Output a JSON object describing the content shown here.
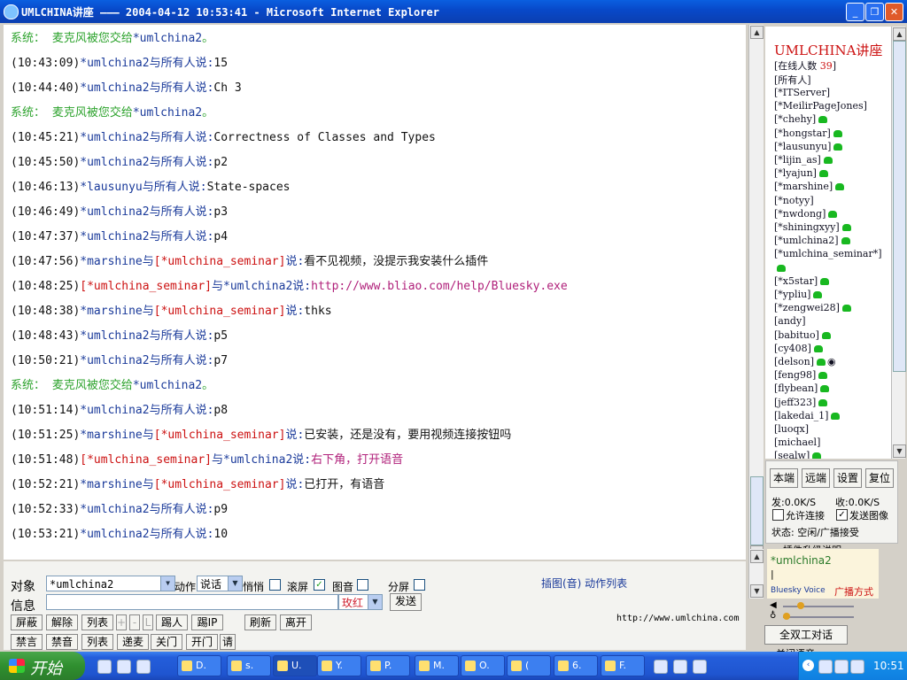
{
  "window": {
    "title": "UMLCHINA讲座 ——— 2004-04-12 10:53:41 - Microsoft Internet Explorer",
    "minimize": "_",
    "maximize": "❐",
    "close": "✕"
  },
  "chat": {
    "lines": [
      {
        "p": [
          "系统：  麦克风被您交给",
          "*umlchina2",
          "。"
        ]
      },
      {
        "p": [
          "(10:43:09)",
          "*umlchina2",
          "与所有人说:",
          "15"
        ]
      },
      {
        "p": [
          "(10:44:40)",
          "*umlchina2",
          "与所有人说:",
          "Ch 3"
        ]
      },
      {
        "p": [
          "系统：  麦克风被您交给",
          "*umlchina2",
          "。"
        ]
      },
      {
        "p": [
          "(10:45:21)",
          "*umlchina2",
          "与所有人说:",
          "Correctness of Classes and Types"
        ]
      },
      {
        "p": [
          "(10:45:50)",
          "*umlchina2",
          "与所有人说:",
          "p2"
        ]
      },
      {
        "p": [
          "(10:46:13)",
          "*lausunyu",
          "与所有人说:",
          "State-spaces"
        ]
      },
      {
        "p": [
          "(10:46:49)",
          "*umlchina2",
          "与所有人说:",
          "p3"
        ]
      },
      {
        "p": [
          "(10:47:37)",
          "*umlchina2",
          "与所有人说:",
          "p4"
        ]
      },
      {
        "p": [
          "(10:47:56)",
          "*marshine",
          "与",
          "[*umlchina_seminar]",
          "说:",
          "看不见视频，没提示我安装什么插件"
        ]
      },
      {
        "p": [
          "(10:48:25)",
          "[*umlchina_seminar]",
          "与",
          "*umlchina2",
          "说:",
          "http://www.bliao.com/help/Bluesky.exe"
        ]
      },
      {
        "p": [
          "(10:48:38)",
          "*marshine",
          "与",
          "[*umlchina_seminar]",
          "说:",
          "thks"
        ]
      },
      {
        "p": [
          "(10:48:43)",
          "*umlchina2",
          "与所有人说:",
          "p5"
        ]
      },
      {
        "p": [
          "(10:50:21)",
          "*umlchina2",
          "与所有人说:",
          "p7"
        ]
      },
      {
        "p": [
          "系统：  麦克风被您交给",
          "*umlchina2",
          "。"
        ]
      },
      {
        "p": [
          "(10:51:14)",
          "*umlchina2",
          "与所有人说:",
          "p8"
        ]
      },
      {
        "p": [
          "(10:51:25)",
          "*marshine",
          "与",
          "[*umlchina_seminar]",
          "说:",
          "已安装，还是没有，要用视频连接按钮吗"
        ]
      },
      {
        "p": [
          "(10:51:48)",
          "[*umlchina_seminar]",
          "与",
          "*umlchina2",
          "说:",
          "右下角，打开语音"
        ]
      },
      {
        "p": [
          "(10:52:21)",
          "*marshine",
          "与",
          "[*umlchina_seminar]",
          "说:",
          "已打开，有语音"
        ]
      },
      {
        "p": [
          "(10:52:33)",
          "*umlchina2",
          "与所有人说:",
          "p9"
        ]
      },
      {
        "p": [
          "(10:53:21)",
          "*umlchina2",
          "与所有人说:",
          "10"
        ]
      }
    ]
  },
  "input": {
    "target_label": "对象",
    "target_value": "*umlchina2",
    "action_label": "动作",
    "action_value": "说话",
    "whisper_label": "悄悄",
    "scroll_label": "滚屏",
    "image_sound_label": "图音",
    "split_label": "分屏",
    "message_label": "信息",
    "message_value": "",
    "color_value": "玫红",
    "send_button": "发送",
    "insert_link": "插图(音) 动作列表",
    "site_url": "http://www.umlchina.com",
    "row1_buttons": [
      "屏蔽",
      "解除",
      "列表",
      "+",
      "-",
      "L",
      "踢人",
      "踢IP",
      "刷新",
      "离开"
    ],
    "row2_buttons": [
      "禁言",
      "禁音",
      "列表",
      "递麦",
      "关门",
      "开门",
      "请"
    ]
  },
  "users": {
    "title": "UMLCHINA讲座",
    "online_label": "[在线人数 ",
    "online_count": "39",
    "online_suffix": "]",
    "everyone": "[所有人]",
    "list": [
      {
        "name": "[*ITServer]",
        "phone": false
      },
      {
        "name": "[*MeilirPageJones]",
        "phone": false
      },
      {
        "name": "[*chehy]",
        "phone": true
      },
      {
        "name": "[*hongstar]",
        "phone": true
      },
      {
        "name": "[*lausunyu]",
        "phone": true
      },
      {
        "name": "[*lijin_as]",
        "phone": true
      },
      {
        "name": "[*lyajun]",
        "phone": true
      },
      {
        "name": "[*marshine]",
        "phone": true
      },
      {
        "name": "[*notyy]",
        "phone": false
      },
      {
        "name": "[*nwdong]",
        "phone": true
      },
      {
        "name": "[*shiningxyy]",
        "phone": true
      },
      {
        "name": "[*umlchina2]",
        "phone": true
      },
      {
        "name": "[*umlchina_seminar*]",
        "phone": false
      },
      {
        "name": "",
        "phone": true
      },
      {
        "name": "[*x5star]",
        "phone": true
      },
      {
        "name": "[*ypliu]",
        "phone": true
      },
      {
        "name": "[*zengwei28]",
        "phone": true
      },
      {
        "name": "[andy]",
        "phone": false
      },
      {
        "name": "[babituo]",
        "phone": true
      },
      {
        "name": "[cy408]",
        "phone": true
      },
      {
        "name": "[delson]",
        "phone": true,
        "eye": true
      },
      {
        "name": "[feng98]",
        "phone": true
      },
      {
        "name": "[flybean]",
        "phone": true
      },
      {
        "name": "[jeff323]",
        "phone": true
      },
      {
        "name": "[lakedai_1]",
        "phone": true
      },
      {
        "name": "[luoqx]",
        "phone": false
      },
      {
        "name": "[michael]",
        "phone": false
      },
      {
        "name": "[sealw]",
        "phone": true
      }
    ]
  },
  "control": {
    "buttons": [
      "本端",
      "远端",
      "设置",
      "复位"
    ],
    "send_rate": "发:0.0K/S",
    "recv_rate": "收:0.0K/S",
    "allow_connect": "允许连接",
    "send_image": "发送图像",
    "status": "状态: 空闲/广播接受",
    "plugin_upgrade": "插件升级说明"
  },
  "voice": {
    "user": "*umlchina2",
    "brand": "Bluesky Voice",
    "mode": "广播方式",
    "full_duplex": "全双工对话",
    "next_label": "关闭语音"
  },
  "taskbar": {
    "start": "开始",
    "items": [
      "D.",
      "s.",
      "U.",
      "Y.",
      "P.",
      "M.",
      "O.",
      "(",
      "6.",
      "F."
    ],
    "clock": "10:51"
  }
}
